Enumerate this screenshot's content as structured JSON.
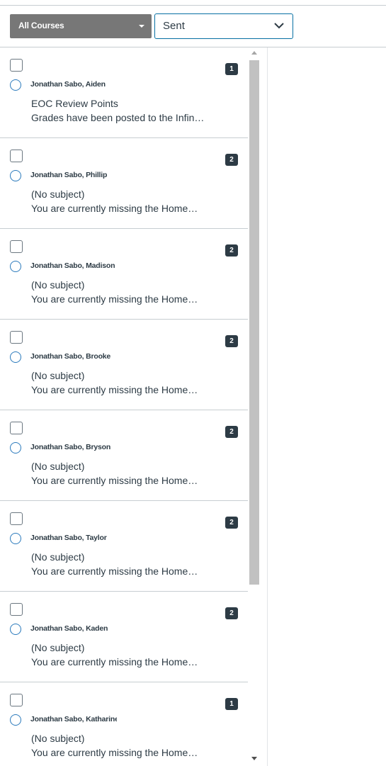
{
  "filters": {
    "course_filter": "All Courses",
    "mailbox_filter": "Sent"
  },
  "conversations": [
    {
      "participants": "Jonathan Sabo, Aiden",
      "count": "1",
      "subject": "EOC Review Points",
      "preview": "Grades have been posted to the Infinite Campus gradebook"
    },
    {
      "participants": "Jonathan Sabo, Phillip",
      "count": "2",
      "subject": "(No subject)",
      "preview": "You are currently missing the Homework assignment"
    },
    {
      "participants": "Jonathan Sabo, Madison",
      "count": "2",
      "subject": "(No subject)",
      "preview": "You are currently missing the Homework assignment"
    },
    {
      "participants": "Jonathan Sabo, Brooke",
      "count": "2",
      "subject": "(No subject)",
      "preview": "You are currently missing the Homework assignment"
    },
    {
      "participants": "Jonathan Sabo, Bryson",
      "count": "2",
      "subject": "(No subject)",
      "preview": "You are currently missing the Homework assignment"
    },
    {
      "participants": "Jonathan Sabo, Taylor",
      "count": "2",
      "subject": "(No subject)",
      "preview": "You are currently missing the Homework assignment"
    },
    {
      "participants": "Jonathan Sabo, Kaden",
      "count": "2",
      "subject": "(No subject)",
      "preview": "You are currently missing the Homework assignment"
    },
    {
      "participants": "Jonathan Sabo, Katharine",
      "count": "1",
      "subject": "(No subject)",
      "preview": "You are currently missing the Homework assignment"
    }
  ],
  "colors": {
    "accent": "#0770a3",
    "unread": "#2b7abc",
    "badge": "#2d3b45",
    "course_select_bg": "#777777"
  },
  "icons": {
    "course_caret": "caret-down-icon",
    "mailbox_chevron": "chevron-down-icon",
    "scroll_up": "arrow-up-icon",
    "scroll_down": "arrow-down-icon"
  }
}
